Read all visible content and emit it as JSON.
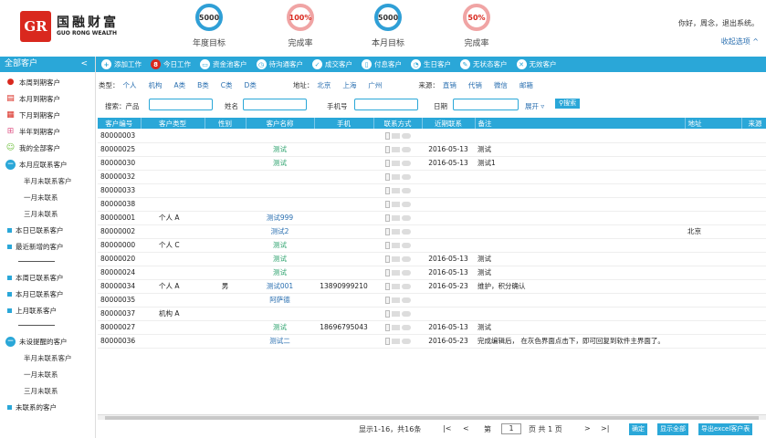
{
  "header": {
    "logo_mark": "GR",
    "logo_cn": "国融财富",
    "logo_en": "GUO RONG WEALTH",
    "kpis": [
      {
        "value": "5000",
        "label": "年度目标"
      },
      {
        "value": "100%",
        "label": "完成率"
      },
      {
        "value": "5000",
        "label": "本月目标"
      },
      {
        "value": "50%",
        "label": "完成率"
      }
    ],
    "greeting": "你好，周念，退出系统。",
    "switch_label": "收起选项 ^"
  },
  "sidebar": {
    "title": "全部客户",
    "collapse": "<",
    "items": [
      {
        "label": "本周到期客户",
        "icon": "car-icon"
      },
      {
        "label": "本月到期客户",
        "icon": "document-icon"
      },
      {
        "label": "下月到期客户",
        "icon": "calendar-icon"
      },
      {
        "label": "半年到期客户",
        "icon": "grid-icon"
      },
      {
        "label": "我的全部客户",
        "icon": "smile-icon"
      },
      {
        "label": "本月应联系客户",
        "icon": "minus-circle-icon"
      },
      {
        "label": "半月未联系客户"
      },
      {
        "label": "一月未联系"
      },
      {
        "label": "三月未联系"
      },
      {
        "label": "本日已联系客户"
      },
      {
        "label": "最近新增的客户"
      },
      {
        "label": "本周已联系客户"
      },
      {
        "label": "本月已联系客户"
      },
      {
        "label": "上月联系客户"
      },
      {
        "label": "未设提醒的客户"
      },
      {
        "label": "半月未联系客户"
      },
      {
        "label": "一月未联系"
      },
      {
        "label": "三月未联系"
      },
      {
        "label": "未联系的客户"
      }
    ]
  },
  "toolbar": [
    {
      "label": "添加工作",
      "icon": "plus-icon"
    },
    {
      "label": "今日工作",
      "icon": "badge-icon",
      "badge": "8"
    },
    {
      "label": "资金池客户",
      "icon": "pool-icon"
    },
    {
      "label": "待沟通客户",
      "icon": "chat-icon"
    },
    {
      "label": "成交客户",
      "icon": "check-icon"
    },
    {
      "label": "付息客户",
      "icon": "doc-icon"
    },
    {
      "label": "生日客户",
      "icon": "cake-icon"
    },
    {
      "label": "无状态客户",
      "icon": "pen-icon"
    },
    {
      "label": "无效客户",
      "icon": "x-icon"
    }
  ],
  "filters": {
    "type_label": "类型：",
    "types": [
      "个人",
      "机构",
      "A类",
      "B类",
      "C类",
      "D类"
    ],
    "addr_label": "地址：",
    "addrs": [
      "北京",
      "上海",
      "广州"
    ],
    "source_label": "来源：",
    "sources": [
      "直销",
      "代销",
      "微信",
      "邮箱"
    ],
    "search_label": "搜索：产品",
    "name_label": "姓名",
    "phone_label": "手机号",
    "date_label": "日期",
    "expand": "展开 ▿",
    "search_btn": "搜索"
  },
  "table": {
    "columns": [
      "客户编号",
      "客户类型",
      "性别",
      "客户名称",
      "手机",
      "联系方式",
      "近期联系",
      "备注",
      "地址",
      "来源"
    ],
    "rows": [
      {
        "id": "80000003",
        "type": "",
        "sex": "",
        "name": "",
        "phone": "",
        "last": "",
        "note": "",
        "addr": ""
      },
      {
        "id": "80000025",
        "type": "",
        "sex": "",
        "name": "测试",
        "phone": "",
        "last": "2016-05-13",
        "note": "测试",
        "addr": ""
      },
      {
        "id": "80000030",
        "type": "",
        "sex": "",
        "name": "测试",
        "phone": "",
        "last": "2016-05-13",
        "note": "测试1",
        "addr": ""
      },
      {
        "id": "80000032",
        "type": "",
        "sex": "",
        "name": "",
        "phone": "",
        "last": "",
        "note": "",
        "addr": ""
      },
      {
        "id": "80000033",
        "type": "",
        "sex": "",
        "name": "",
        "phone": "",
        "last": "",
        "note": "",
        "addr": ""
      },
      {
        "id": "80000038",
        "type": "",
        "sex": "",
        "name": "",
        "phone": "",
        "last": "",
        "note": "",
        "addr": ""
      },
      {
        "id": "80000001",
        "type": "个人 A",
        "sex": "",
        "name": "测试999",
        "phone": "",
        "last": "",
        "note": "",
        "addr": ""
      },
      {
        "id": "80000002",
        "type": "",
        "sex": "",
        "name": "测试2",
        "phone": "",
        "last": "",
        "note": "",
        "addr": "北京"
      },
      {
        "id": "80000000",
        "type": "个人 C",
        "sex": "",
        "name": "测试",
        "phone": "",
        "last": "",
        "note": "",
        "addr": ""
      },
      {
        "id": "80000020",
        "type": "",
        "sex": "",
        "name": "测试",
        "phone": "",
        "last": "2016-05-13",
        "note": "测试",
        "addr": ""
      },
      {
        "id": "80000024",
        "type": "",
        "sex": "",
        "name": "测试",
        "phone": "",
        "last": "2016-05-13",
        "note": "测试",
        "addr": ""
      },
      {
        "id": "80000034",
        "type": "个人 A",
        "sex": "男",
        "name": "测试001",
        "phone": "13890999210",
        "last": "2016-05-23",
        "note": "维护，积分确认",
        "addr": ""
      },
      {
        "id": "80000035",
        "type": "",
        "sex": "",
        "name": "阿萨德",
        "phone": "",
        "last": "",
        "note": "",
        "addr": ""
      },
      {
        "id": "80000037",
        "type": "机构 A",
        "sex": "",
        "name": "",
        "phone": "",
        "last": "",
        "note": "",
        "addr": ""
      },
      {
        "id": "80000027",
        "type": "",
        "sex": "",
        "name": "测试",
        "phone": "18696795043",
        "last": "2016-05-13",
        "note": "测试",
        "addr": ""
      },
      {
        "id": "80000036",
        "type": "",
        "sex": "",
        "name": "测试二",
        "phone": "",
        "last": "2016-05-23",
        "note": "完成编辑后， 在灰色界面点击下，即可回复到软件主界面了。",
        "addr": ""
      }
    ]
  },
  "pager": {
    "summary": "显示1-16，共16条",
    "first": "|<",
    "prev": "<",
    "page_prefix": "第",
    "page": "1",
    "page_suffix": "页 共 1 页",
    "next": ">",
    "last": ">|",
    "confirm": "确定",
    "show_all": "显示全部",
    "export": "导出excel客户表"
  },
  "colors": {
    "accent": "#2aa7d8",
    "brand": "#d9281e"
  }
}
